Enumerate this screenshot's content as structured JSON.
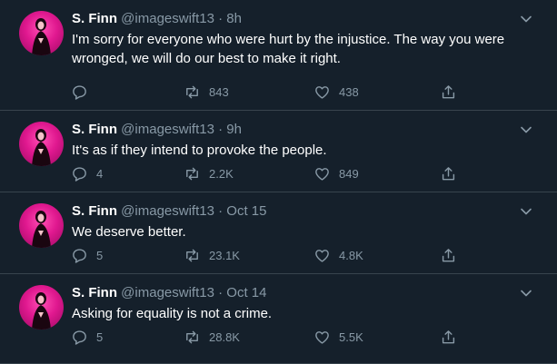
{
  "tweets": [
    {
      "name": "S. Finn",
      "handle": "@imageswift13",
      "separator": "·",
      "time": "8h",
      "text": "I'm sorry for everyone who were hurt by the injustice. The way you were wronged, we will do our best to make it right.",
      "replies": "",
      "retweets": "843",
      "likes": "438"
    },
    {
      "name": "S. Finn",
      "handle": "@imageswift13",
      "separator": "·",
      "time": "9h",
      "text": "It's as if they intend to provoke the people.",
      "replies": "4",
      "retweets": "2.2K",
      "likes": "849"
    },
    {
      "name": "S. Finn",
      "handle": "@imageswift13",
      "separator": "·",
      "time": "Oct 15",
      "text": "We deserve better.",
      "replies": "5",
      "retweets": "23.1K",
      "likes": "4.8K"
    },
    {
      "name": "S. Finn",
      "handle": "@imageswift13",
      "separator": "·",
      "time": "Oct 14",
      "text": "Asking for equality is not a crime.",
      "replies": "5",
      "retweets": "28.8K",
      "likes": "5.5K"
    }
  ],
  "icons": {
    "reply": "reply-icon",
    "retweet": "retweet-icon",
    "like": "heart-icon",
    "share": "share-icon",
    "more": "chevron-down-icon"
  },
  "colors": {
    "background": "#15202b",
    "secondary_text": "#8899a6",
    "divider": "#38444d",
    "avatar_pink": "#e0188f"
  }
}
